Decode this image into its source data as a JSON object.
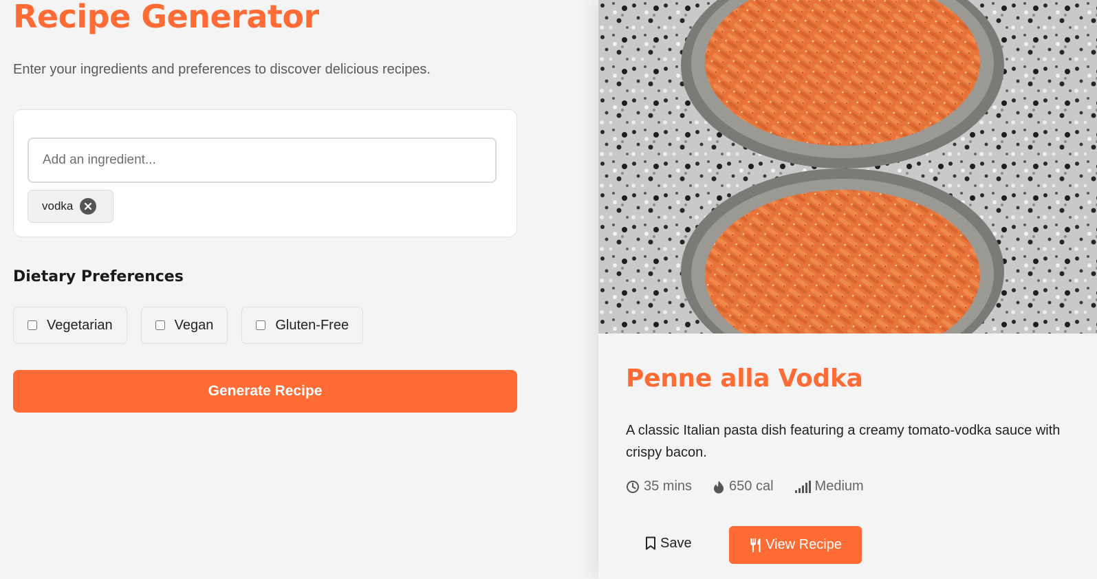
{
  "generator": {
    "title": "Recipe Generator",
    "subtitle": "Enter your ingredients and preferences to discover delicious recipes.",
    "ingredient_input": {
      "placeholder": "Add an ingredient...",
      "value": ""
    },
    "ingredients": [
      {
        "label": "vodka"
      }
    ],
    "dietary": {
      "title": "Dietary Preferences",
      "options": [
        {
          "label": "Vegetarian",
          "checked": false
        },
        {
          "label": "Vegan",
          "checked": false
        },
        {
          "label": "Gluten-Free",
          "checked": false
        }
      ]
    },
    "generate_label": "Generate Recipe"
  },
  "recipe": {
    "title": "Penne alla Vodka",
    "description": "A classic Italian pasta dish featuring a creamy tomato-vodka sauce with crispy bacon.",
    "time": "35 mins",
    "calories": "650 cal",
    "difficulty": "Medium",
    "save_label": "Save",
    "view_label": "View Recipe"
  },
  "icons": {
    "time": "clock-icon",
    "calories": "flame-icon",
    "difficulty": "signal-bars-icon",
    "save": "bookmark-icon",
    "view": "utensils-icon",
    "remove_chip": "close-circle-icon"
  },
  "colors": {
    "accent": "#ff6b35",
    "background": "#f4f4f4",
    "card": "#ffffff"
  }
}
